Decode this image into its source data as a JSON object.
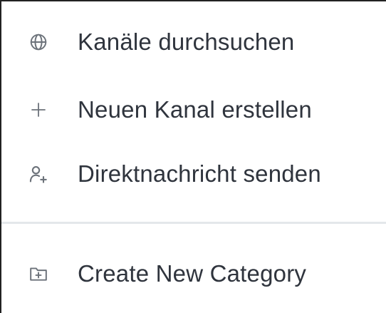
{
  "menu": {
    "items": [
      {
        "label": "Kanäle durchsuchen",
        "icon": "globe-icon"
      },
      {
        "label": "Neuen Kanal erstellen",
        "icon": "plus-icon"
      },
      {
        "label": "Direktnachricht senden",
        "icon": "user-plus-icon"
      }
    ],
    "secondary_items": [
      {
        "label": "Create New Category",
        "icon": "folder-plus-icon"
      }
    ]
  },
  "colors": {
    "text": "#2f343d",
    "icon": "#6c727a",
    "divider": "#e4e7ea",
    "border": "#222222"
  }
}
